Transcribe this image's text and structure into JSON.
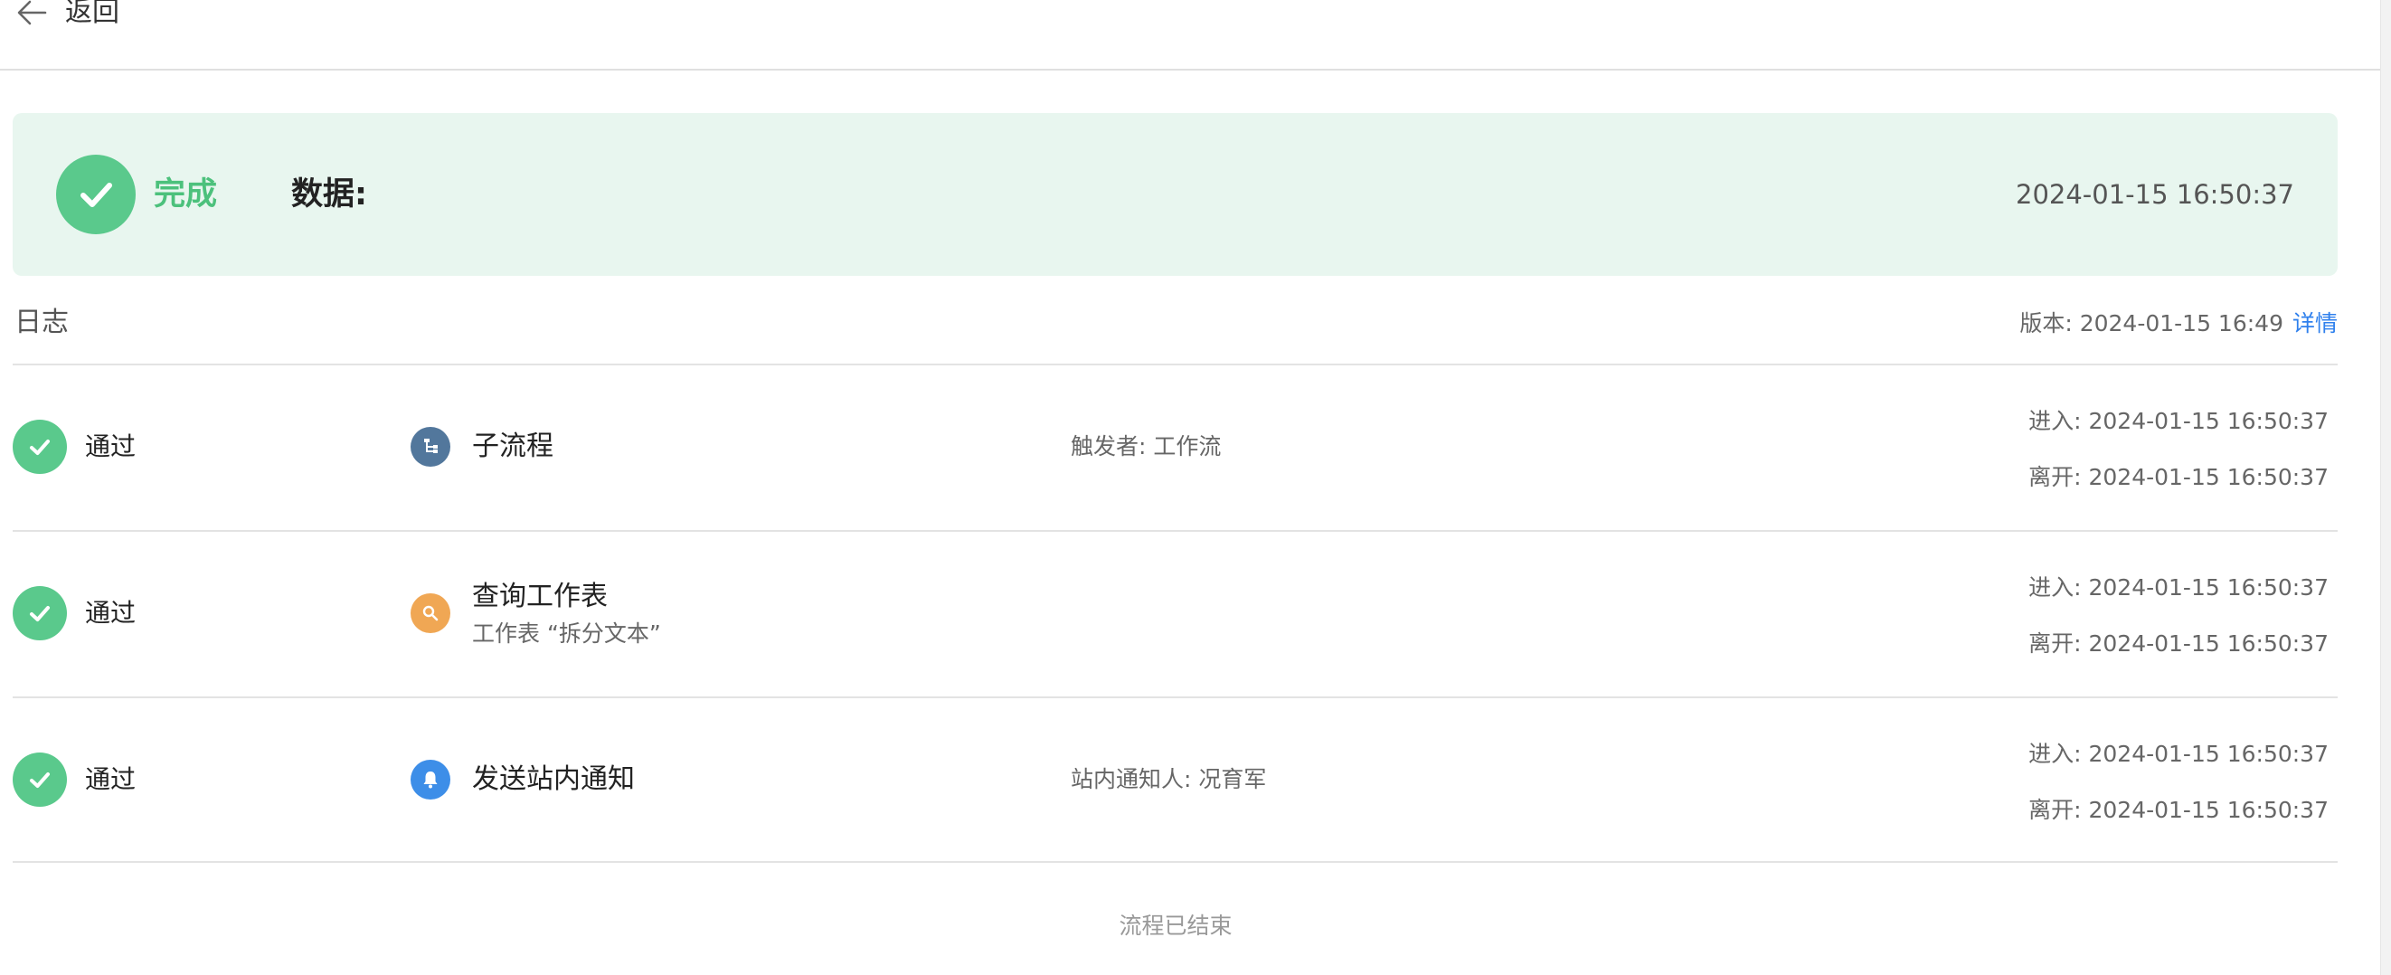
{
  "header": {
    "back_label": "返回"
  },
  "summary": {
    "status": "完成",
    "data_label": "数据:",
    "time": "2024-01-15 16:50:37",
    "colors": {
      "success": "#5ac98c",
      "background": "#e8f6ef"
    }
  },
  "log": {
    "title": "日志",
    "version_label": "版本: 2024-01-15 16:49",
    "detail_link": "详情",
    "rows": [
      {
        "status": "通过",
        "icon": "subprocess-icon",
        "icon_color": "#52779c",
        "title": "子流程",
        "subtitle": "",
        "meta": "触发者: 工作流",
        "enter": "进入: 2024-01-15 16:50:37",
        "leave": "离开: 2024-01-15 16:50:37"
      },
      {
        "status": "通过",
        "icon": "search-icon",
        "icon_color": "#f0a754",
        "title": "查询工作表",
        "subtitle": "工作表 “拆分文本”",
        "meta": "",
        "enter": "进入: 2024-01-15 16:50:37",
        "leave": "离开: 2024-01-15 16:50:37"
      },
      {
        "status": "通过",
        "icon": "bell-icon",
        "icon_color": "#3d8ee8",
        "title": "发送站内通知",
        "subtitle": "",
        "meta": "站内通知人: 况育军",
        "enter": "进入: 2024-01-15 16:50:37",
        "leave": "离开: 2024-01-15 16:50:37"
      }
    ],
    "end_text": "流程已结束"
  }
}
